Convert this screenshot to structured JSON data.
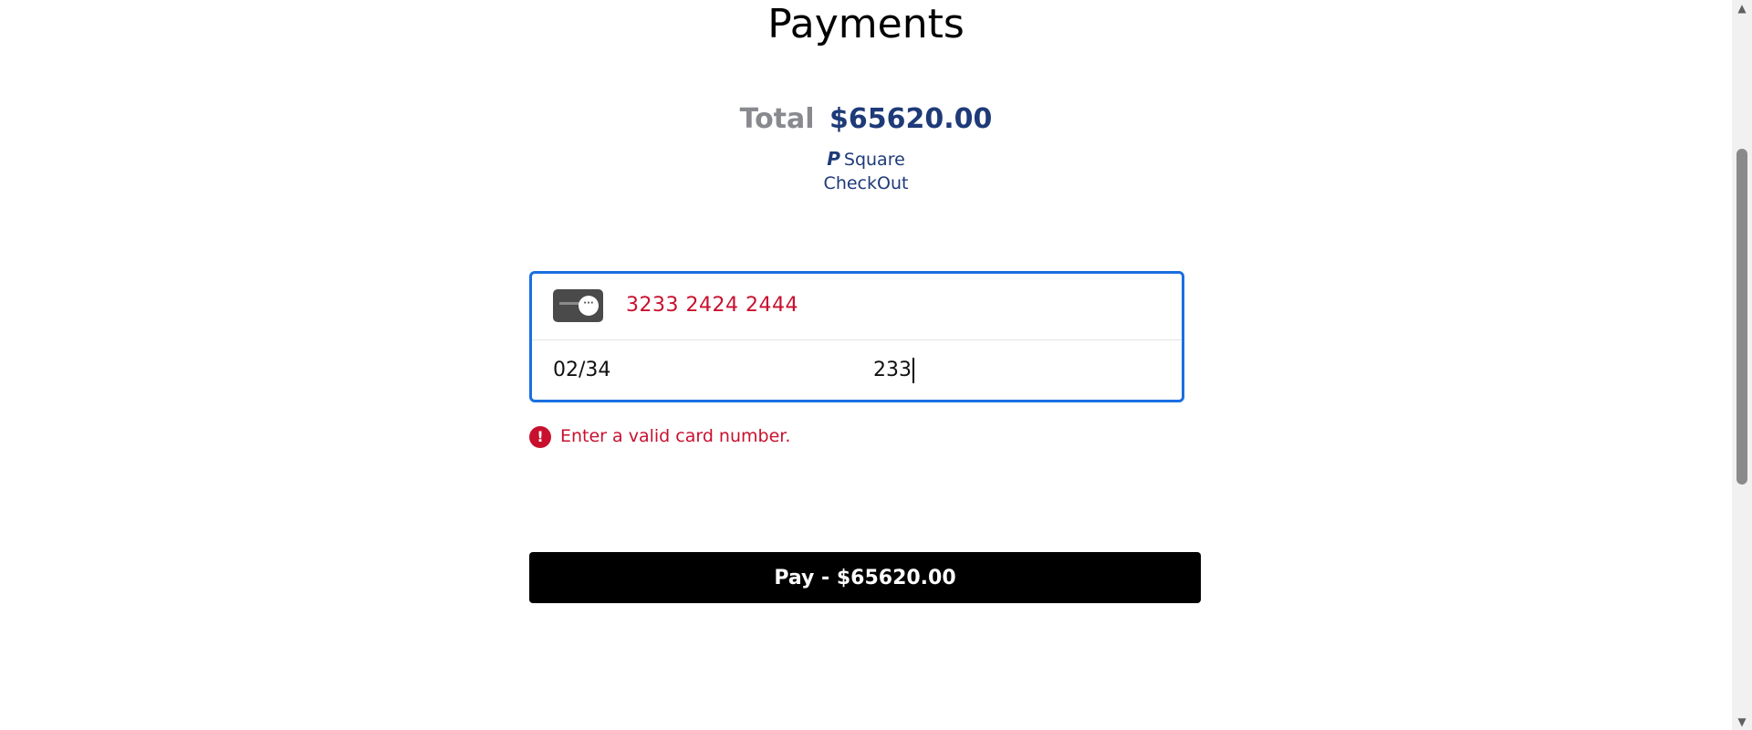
{
  "page": {
    "title": "Payments"
  },
  "summary": {
    "total_label": "Total",
    "total_amount": "$65620.00"
  },
  "checkout": {
    "icon": "paypal-icon",
    "label": "Square",
    "label2": "CheckOut"
  },
  "card_form": {
    "card_number": "3233 2424 2444",
    "expiry": "02/34",
    "cvv": "233",
    "card_icon": "credit-card-icon",
    "border_color": "#1a6fe0",
    "error_color": "#c8102e"
  },
  "error": {
    "icon": "error-circle-icon",
    "message": "Enter a valid card number."
  },
  "pay_button": {
    "label": "Pay - $65620.00"
  }
}
